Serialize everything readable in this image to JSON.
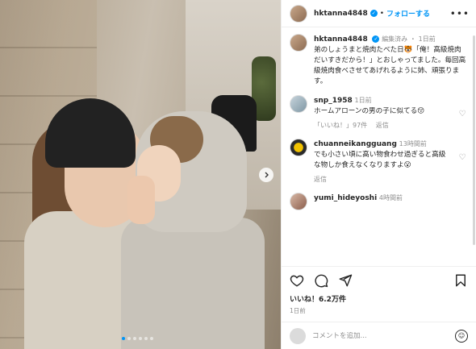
{
  "post_header": {
    "username": "hktanna4848",
    "separator": "•",
    "follow_label": "フォローする",
    "more_label": "•••"
  },
  "caption": {
    "username": "hktanna4848",
    "edited": "編集済み",
    "age": "1日前",
    "text": "弟のしょうまと焼肉たべた日🐯「俺！高級焼肉だいすきだから！」とおしゃってました。毎回高級焼肉食べさせてあげれるように姉、頑張ります。"
  },
  "comments": [
    {
      "username": "snp_1958",
      "age": "1日前",
      "text": "ホームアローンの男の子に似てる😚",
      "likes": "「いいね！」97件",
      "reply": "返信"
    },
    {
      "username": "chuanneikangguang",
      "age": "13時間前",
      "text": "でも小さい頃に高い物食わせ過ぎると高級な物しか食えなくなりますよ😮",
      "reply": "返信"
    },
    {
      "username": "yumi_hideyoshi",
      "age": "4時間前"
    }
  ],
  "footer": {
    "likes": "いいね！6.2万件",
    "date": "1日前",
    "comment_placeholder": "コメントを追加..."
  },
  "carousel": {
    "slides": 6,
    "current": 0
  },
  "colors": {
    "accent": "#0095f6",
    "muted": "#8e8e8e",
    "text": "#262626"
  }
}
